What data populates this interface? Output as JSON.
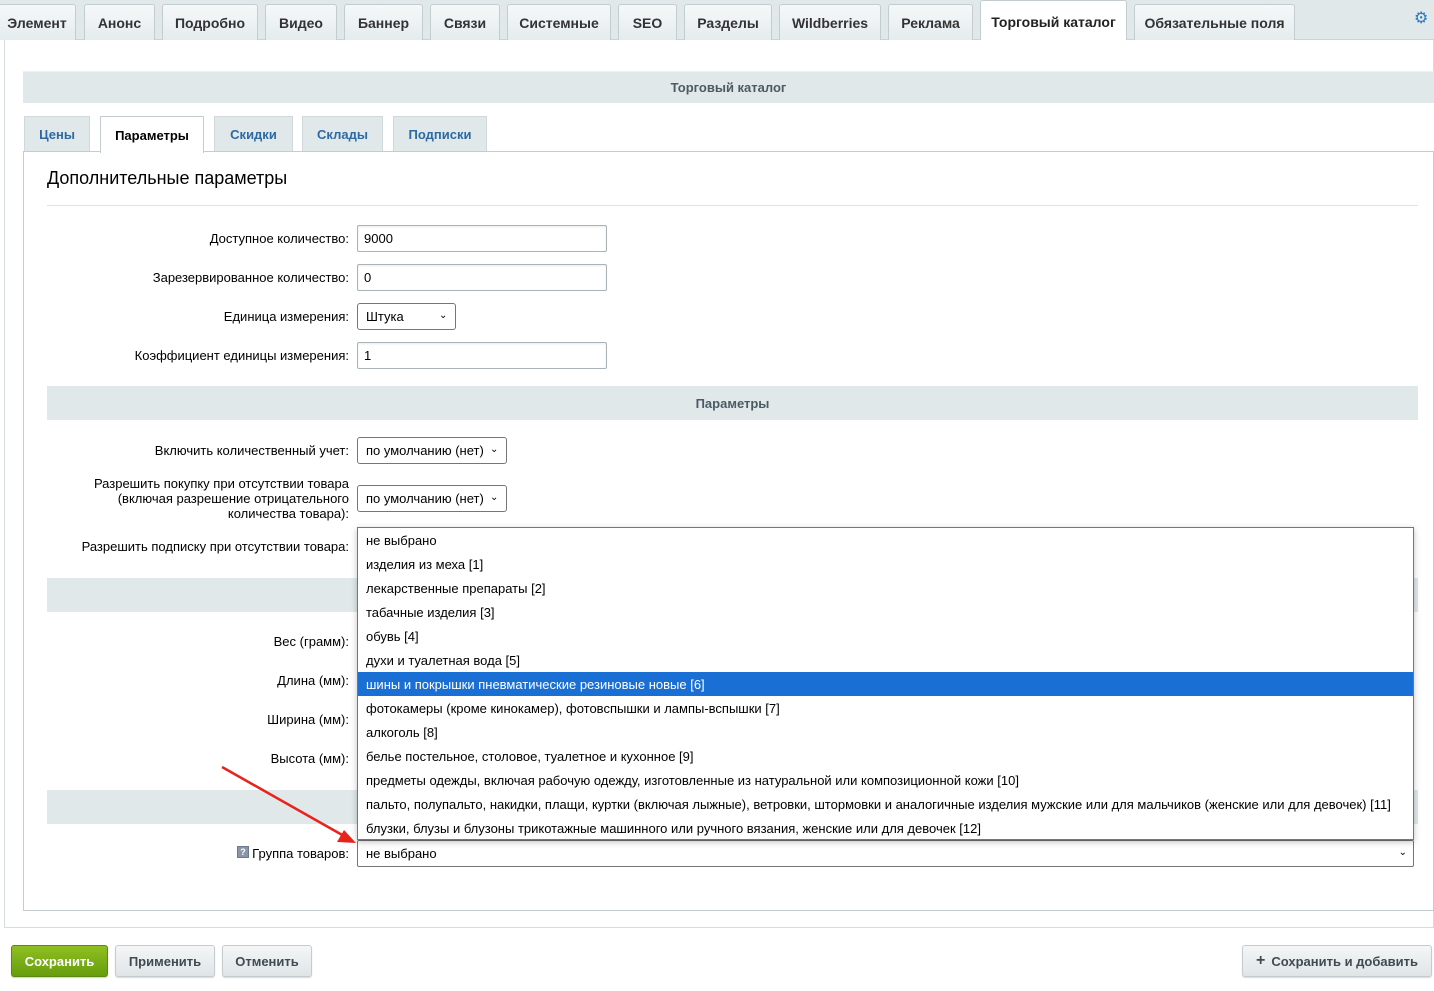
{
  "top_tabs": [
    {
      "label": "Элемент"
    },
    {
      "label": "Анонс"
    },
    {
      "label": "Подробно"
    },
    {
      "label": "Видео"
    },
    {
      "label": "Баннер"
    },
    {
      "label": "Связи"
    },
    {
      "label": "Системные"
    },
    {
      "label": "SEO"
    },
    {
      "label": "Разделы"
    },
    {
      "label": "Wildberries"
    },
    {
      "label": "Реклама"
    },
    {
      "label": "Торговый каталог"
    },
    {
      "label": "Обязательные поля"
    }
  ],
  "active_top_tab": "Торговый каталог",
  "catalog_header": "Торговый каталог",
  "inner_tabs": [
    {
      "label": "Цены"
    },
    {
      "label": "Параметры"
    },
    {
      "label": "Скидки"
    },
    {
      "label": "Склады"
    },
    {
      "label": "Подписки"
    }
  ],
  "active_inner_tab": "Параметры",
  "section_title": "Дополнительные параметры",
  "fields": {
    "available_qty": {
      "label": "Доступное количество:",
      "value": "9000"
    },
    "reserved_qty": {
      "label": "Зарезервированное количество:",
      "value": "0"
    },
    "unit": {
      "label": "Единица измерения:",
      "value": "Штука"
    },
    "unit_ratio": {
      "label": "Коэффициент единицы измерения:",
      "value": "1"
    }
  },
  "params_band": "Параметры",
  "params": {
    "qty_trace": {
      "label": "Включить количественный учет:",
      "value": "по умолчанию (нет)"
    },
    "can_buy_zero": {
      "label_line1": "Разрешить покупку при отсутствии товара",
      "label_line2": "(включая разрешение отрицательного",
      "label_line3": "количества товара):",
      "value": "по умолчанию (нет)"
    },
    "subscribe": {
      "label": "Разрешить подписку при отсутствии товара:"
    }
  },
  "dimensions": {
    "weight": {
      "label": "Вес (грамм):"
    },
    "length": {
      "label": "Длина (мм):"
    },
    "width": {
      "label": "Ширина (мм):"
    },
    "height": {
      "label": "Высота (мм):"
    }
  },
  "product_group": {
    "label": "Группа товаров:",
    "value": "не выбрано",
    "options": [
      "не выбрано",
      "изделия из меха [1]",
      "лекарственные препараты [2]",
      "табачные изделия [3]",
      "обувь [4]",
      "духи и туалетная вода [5]",
      "шины и покрышки пневматические резиновые новые [6]",
      "фотокамеры (кроме кинокамер), фотовспышки и лампы-вспышки [7]",
      "алкоголь [8]",
      "белье постельное, столовое, туалетное и кухонное [9]",
      "предметы одежды, включая рабочую одежду, изготовленные из натуральной или композиционной кожи [10]",
      "пальто, полупальто, накидки, плащи, куртки (включая лыжные), ветровки, штормовки и аналогичные изделия мужские или для мальчиков (женские или для девочек) [11]",
      "блузки, блузы и блузоны трикотажные машинного или ручного вязания, женские или для девочек [12]"
    ],
    "highlighted_option": "шины и покрышки пневматические резиновые новые [6]"
  },
  "buttons": {
    "save": "Сохранить",
    "apply": "Применить",
    "cancel": "Отменить",
    "save_add": "Сохранить и добавить"
  },
  "colors": {
    "accent_green": "#7aaf17",
    "highlight_blue": "#1a6fd4",
    "arrow_red": "#e8231b"
  }
}
